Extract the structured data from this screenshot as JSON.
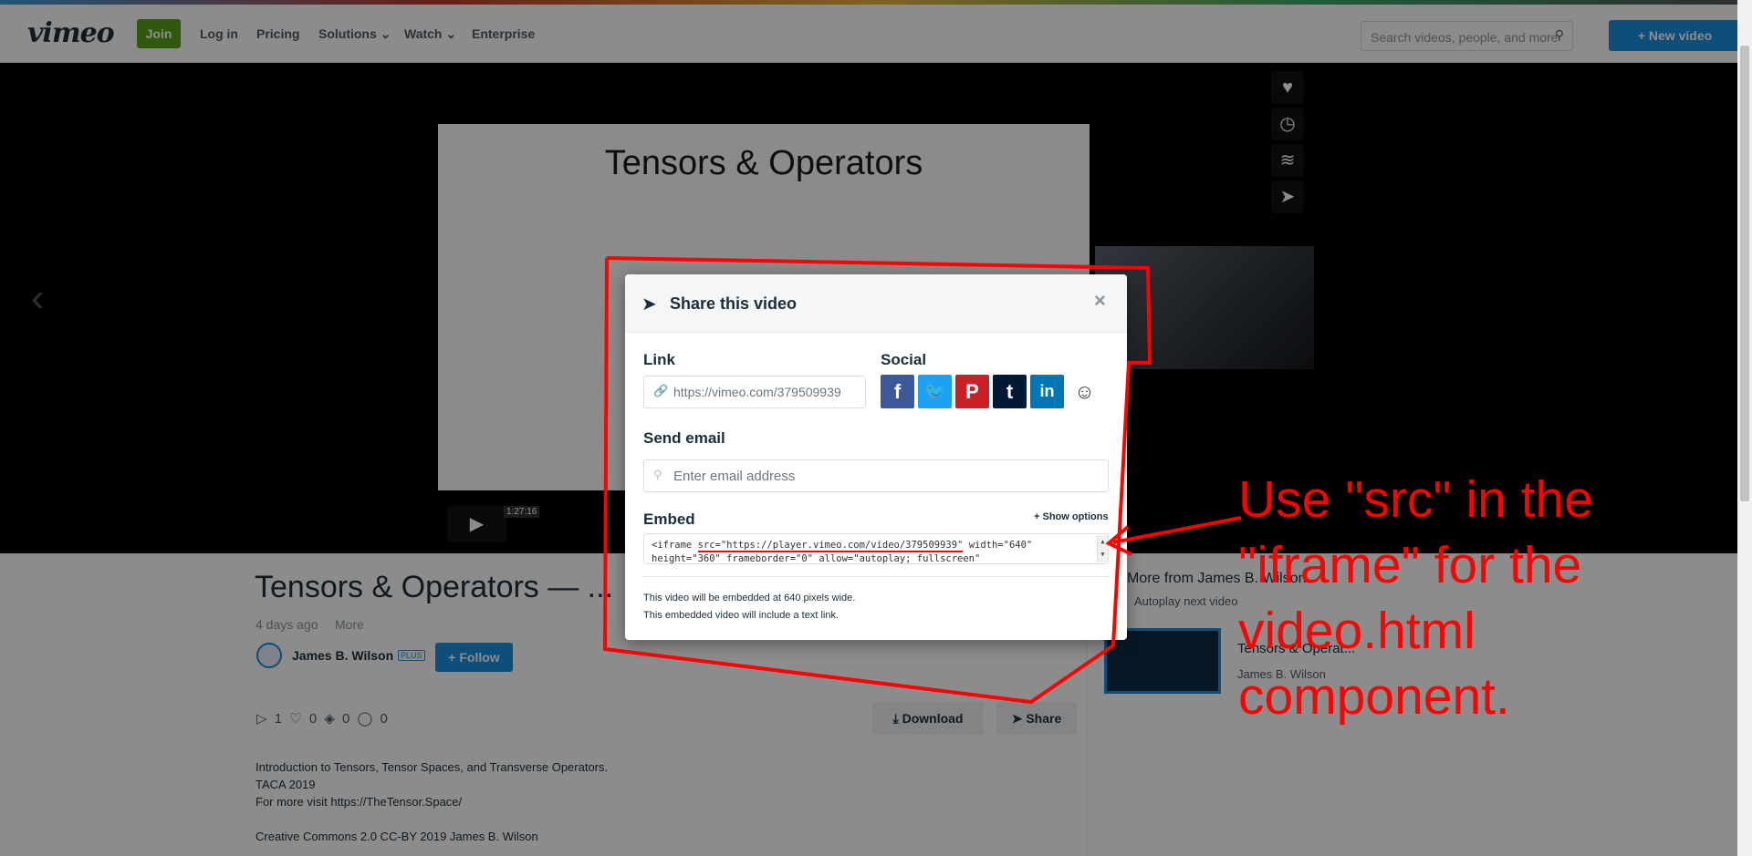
{
  "header": {
    "logo": "vimeo",
    "join": "Join",
    "login": "Log in",
    "pricing": "Pricing",
    "solutions": "Solutions ⌄",
    "watch": "Watch ⌄",
    "enterprise": "Enterprise",
    "search_placeholder": "Search videos, people, and more",
    "new_video": "+ New video"
  },
  "player": {
    "slide_title": "Tensors & Operators",
    "time": "1:27:16"
  },
  "page": {
    "title": "Tensors & Operators — ...",
    "age": "4 days ago",
    "more": "More",
    "uploader": "James B. Wilson",
    "plus": "PLUS",
    "follow": "+ Follow",
    "stats": "▷ 1   ♡ 0   ◈ 0   ◯ 0",
    "download": "Download",
    "share": "Share",
    "description": [
      "Introduction to Tensors, Tensor Spaces, and Transverse Operators.",
      "TACA 2019",
      "For more visit https://TheTensor.Space/",
      "",
      "Creative Commons 2.0 CC-BY 2019 James B. Wilson"
    ]
  },
  "sidebar": {
    "more_from": "More from James B. Wilson",
    "autoplay": "Autoplay next video",
    "rec_title": "Tensors & Operat...",
    "rec_author": "James B. Wilson"
  },
  "modal": {
    "title": "Share this video",
    "close": "×",
    "link_label": "Link",
    "link_value": "https://vimeo.com/379509939",
    "social_label": "Social",
    "email_label": "Send email",
    "email_placeholder": "Enter email address",
    "embed_label": "Embed",
    "show_options": "+ Show options",
    "embed_line1_pre": "<iframe ",
    "embed_line1_src": "src=\"https://player.vimeo.com/video/379509939\"",
    "embed_line1_post": " width=\"640\"",
    "embed_line2": "height=\"360\" frameborder=\"0\" allow=\"autoplay; fullscreen\"",
    "note1": "This video will be embedded at 640 pixels wide.",
    "note2": "This embedded video will include a text link."
  },
  "annotation": {
    "line1": "Use \"src\" in the",
    "line2": "\"iframe\" for the",
    "line3": "video.html",
    "line4": "component."
  },
  "colors": {
    "annotation": "#ff0000",
    "brand_blue": "#1a8ee1",
    "join_green": "#5aa21b"
  }
}
